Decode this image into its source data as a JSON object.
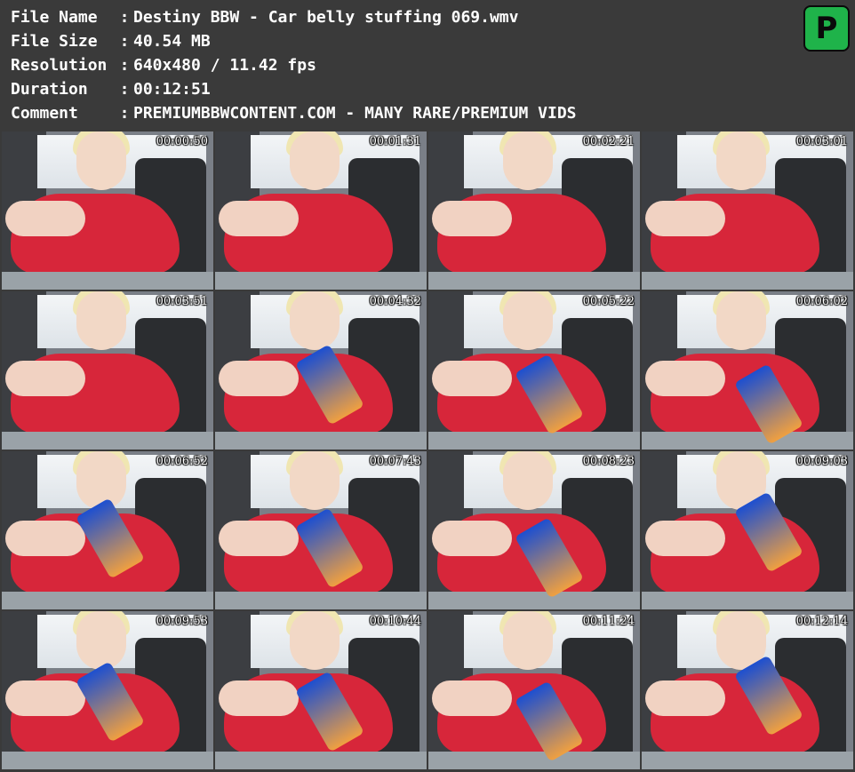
{
  "header": {
    "rows": [
      {
        "key": "File Name",
        "sep": ":",
        "value": "Destiny BBW - Car belly stuffing 069.wmv"
      },
      {
        "key": "File Size",
        "sep": ":",
        "value": "40.54 MB"
      },
      {
        "key": "Resolution",
        "sep": ":",
        "value": "640x480 / 11.42 fps"
      },
      {
        "key": "Duration",
        "sep": ":",
        "value": "00:12:51"
      },
      {
        "key": "Comment",
        "sep": ":",
        "value": "PREMIUMBBWCONTENT.COM - MANY RARE/PREMIUM VIDS"
      }
    ],
    "logo_letter": "P",
    "logo_color": "#1fb34a"
  },
  "thumbnails": [
    {
      "timestamp": "00:00:50",
      "has_bag": false
    },
    {
      "timestamp": "00:01:31",
      "has_bag": false
    },
    {
      "timestamp": "00:02:21",
      "has_bag": false
    },
    {
      "timestamp": "00:03:01",
      "has_bag": false
    },
    {
      "timestamp": "00:03:51",
      "has_bag": false
    },
    {
      "timestamp": "00:04:32",
      "has_bag": true
    },
    {
      "timestamp": "00:05:22",
      "has_bag": true
    },
    {
      "timestamp": "00:06:02",
      "has_bag": true
    },
    {
      "timestamp": "00:06:52",
      "has_bag": true
    },
    {
      "timestamp": "00:07:43",
      "has_bag": true
    },
    {
      "timestamp": "00:08:23",
      "has_bag": true
    },
    {
      "timestamp": "00:09:03",
      "has_bag": true
    },
    {
      "timestamp": "00:09:53",
      "has_bag": true
    },
    {
      "timestamp": "00:10:44",
      "has_bag": true
    },
    {
      "timestamp": "00:11:24",
      "has_bag": true
    },
    {
      "timestamp": "00:12:14",
      "has_bag": true
    }
  ]
}
